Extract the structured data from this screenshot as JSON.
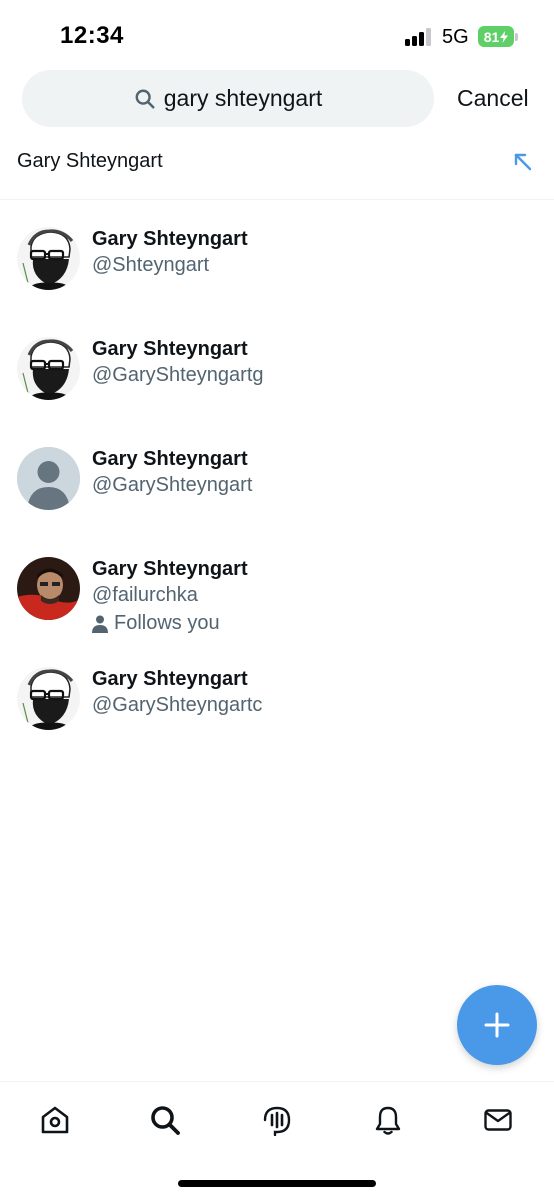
{
  "status_bar": {
    "time": "12:34",
    "network": "5G",
    "battery": "81"
  },
  "search": {
    "query": "gary shteyngart",
    "cancel_label": "Cancel"
  },
  "suggestion": {
    "text": "Gary Shteyngart"
  },
  "results": [
    {
      "name": "Gary Shteyngart",
      "handle": "@Shteyngart",
      "avatar": "sketch-portrait"
    },
    {
      "name": "Gary Shteyngart",
      "handle": "@GaryShteyngartg",
      "avatar": "sketch-portrait"
    },
    {
      "name": "Gary Shteyngart",
      "handle": "@GaryShteyngart",
      "avatar": "default-avatar"
    },
    {
      "name": "Gary Shteyngart",
      "handle": "@failurchka",
      "follows_label": "Follows you",
      "avatar": "photo-portrait"
    },
    {
      "name": "Gary Shteyngart",
      "handle": "@GaryShteyngartc",
      "avatar": "sketch-portrait"
    }
  ],
  "nav": {
    "items": [
      "home-icon",
      "search-icon",
      "spaces-icon",
      "notifications-icon",
      "messages-icon"
    ]
  },
  "colors": {
    "accent": "#4a99e9",
    "secondary_text": "#536471",
    "search_bg": "#eff3f4",
    "battery": "#5fd068"
  }
}
